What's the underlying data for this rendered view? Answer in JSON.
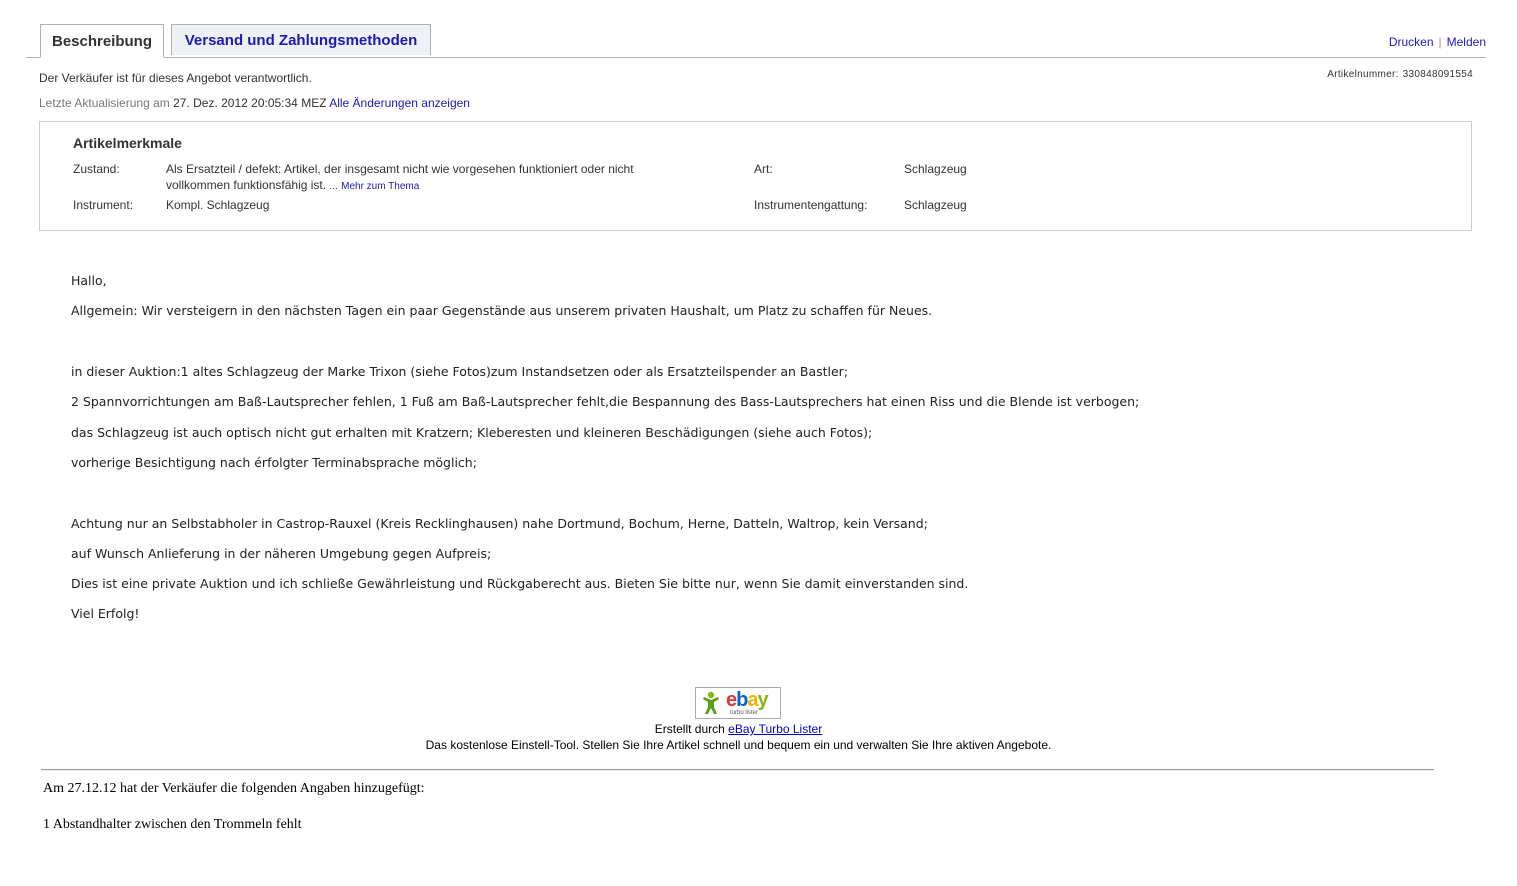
{
  "tabs": [
    {
      "label": "Beschreibung",
      "active": true
    },
    {
      "label": "Versand und Zahlungsmethoden",
      "active": false
    }
  ],
  "toplinks": {
    "print": "Drucken",
    "separator": "|",
    "report": "Melden"
  },
  "responsibility": "Der Verkäufer ist für dieses Angebot verantwortlich.",
  "item_number": {
    "label": "Artikelnummer:",
    "value": "330848091554"
  },
  "last_update": {
    "label": "Letzte Aktualisierung am",
    "date": "27. Dez. 2012 20:05:34 MEZ",
    "link": "Alle Änderungen anzeigen"
  },
  "specifics": {
    "title": "Artikelmerkmale",
    "condition_label": "Zustand:",
    "condition_value_line1": "Als Ersatzteil / defekt: Artikel, der insgesamt nicht wie vorgesehen funktioniert oder nicht",
    "condition_value_line2": "vollkommen funktionsfähig ist.",
    "condition_ellipsis": "...",
    "condition_more": "Mehr zum Thema",
    "type_label": "Art:",
    "type_value": "Schlagzeug",
    "instrument_label": "Instrument:",
    "instrument_value": "Kompl. Schlagzeug",
    "category_label": "Instrumentengattung:",
    "category_value": "Schlagzeug"
  },
  "description": [
    "Hallo,",
    "Allgemein: Wir versteigern in den nächsten Tagen ein paar Gegenstände aus unserem privaten Haushalt, um Platz zu schaffen für Neues.",
    "in dieser Auktion:1 altes Schlagzeug der Marke Trixon (siehe Fotos)zum Instandsetzen oder als Ersatzteilspender an Bastler;",
    "2 Spannvorrichtungen am Baß-Lautsprecher fehlen, 1 Fuß am Baß-Lautsprecher fehlt,die Bespannung des Bass-Lautsprechers hat einen Riss und die Blende ist verbogen;",
    "das Schlagzeug ist auch optisch nicht gut erhalten mit Kratzern; Kleberesten und kleineren Beschädigungen (siehe auch Fotos);",
    "vorherige Besichtigung nach érfolgter Terminabsprache möglich;",
    "Achtung nur an Selbstabholer in Castrop-Rauxel (Kreis Recklinghausen) nahe Dortmund, Bochum, Herne, Datteln, Waltrop, kein Versand;",
    "auf Wunsch Anlieferung in der näheren Umgebung gegen Aufpreis;",
    "Dies ist eine private Auktion und ich schließe Gewährleistung und Rückgaberecht aus. Bieten Sie bitte nur, wenn Sie damit einverstanden sind.",
    "Viel Erfolg!"
  ],
  "turbo_lister": {
    "logo_text": "ebay",
    "logo_sub": "turbo lister",
    "created_by": "Erstellt durch",
    "link": "eBay Turbo Lister",
    "tagline": "Das kostenlose Einstell-Tool. Stellen Sie Ihre Artikel schnell und bequem ein und verwalten Sie Ihre aktiven Angebote."
  },
  "addendum": {
    "header": "Am 27.12.12 hat der Verkäufer die folgenden Angaben hinzugefügt:",
    "text": "1 Abstandhalter zwischen den Trommeln fehlt"
  }
}
